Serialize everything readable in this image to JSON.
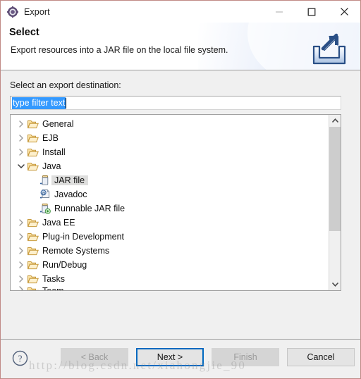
{
  "window": {
    "title": "Export",
    "title_icon": "export-wizard-icon",
    "controls": [
      {
        "name": "minimize-button",
        "glyph": "minimize-icon",
        "disabled": true
      },
      {
        "name": "maximize-button",
        "glyph": "maximize-icon",
        "disabled": false
      },
      {
        "name": "close-button",
        "glyph": "close-icon",
        "disabled": false
      }
    ]
  },
  "banner": {
    "title": "Select",
    "description": "Export resources into a JAR file on the local file system.",
    "icon": "export-arrow-tray-icon"
  },
  "form": {
    "label": "Select an export destination:",
    "filter": {
      "value": "type filter text",
      "placeholder": "type filter text",
      "selected": true
    }
  },
  "tree": {
    "items": [
      {
        "label": "General",
        "icon": "folder-icon",
        "twisty": "chevron-right-icon",
        "level": 1,
        "expanded": false,
        "selected": false
      },
      {
        "label": "EJB",
        "icon": "folder-icon",
        "twisty": "chevron-right-icon",
        "level": 1,
        "expanded": false,
        "selected": false
      },
      {
        "label": "Install",
        "icon": "folder-icon",
        "twisty": "chevron-right-icon",
        "level": 1,
        "expanded": false,
        "selected": false
      },
      {
        "label": "Java",
        "icon": "folder-icon",
        "twisty": "chevron-down-icon",
        "level": 1,
        "expanded": true,
        "selected": false
      },
      {
        "label": "JAR file",
        "icon": "jar-file-icon",
        "twisty": "",
        "level": 2,
        "expanded": false,
        "selected": true
      },
      {
        "label": "Javadoc",
        "icon": "javadoc-icon",
        "twisty": "",
        "level": 2,
        "expanded": false,
        "selected": false
      },
      {
        "label": "Runnable JAR file",
        "icon": "runnable-jar-icon",
        "twisty": "",
        "level": 2,
        "expanded": false,
        "selected": false
      },
      {
        "label": "Java EE",
        "icon": "folder-icon",
        "twisty": "chevron-right-icon",
        "level": 1,
        "expanded": false,
        "selected": false
      },
      {
        "label": "Plug-in Development",
        "icon": "folder-icon",
        "twisty": "chevron-right-icon",
        "level": 1,
        "expanded": false,
        "selected": false
      },
      {
        "label": "Remote Systems",
        "icon": "folder-icon",
        "twisty": "chevron-right-icon",
        "level": 1,
        "expanded": false,
        "selected": false
      },
      {
        "label": "Run/Debug",
        "icon": "folder-icon",
        "twisty": "chevron-right-icon",
        "level": 1,
        "expanded": false,
        "selected": false
      },
      {
        "label": "Tasks",
        "icon": "folder-icon",
        "twisty": "chevron-right-icon",
        "level": 1,
        "expanded": false,
        "selected": false
      },
      {
        "label": "Team",
        "icon": "folder-icon",
        "twisty": "chevron-right-icon",
        "level": 1,
        "expanded": false,
        "selected": false,
        "clipped": true
      }
    ],
    "scrollbar": {
      "up_icon": "scroll-up-arrow-icon",
      "down_icon": "scroll-down-arrow-icon",
      "thumb_position_percent": 0,
      "thumb_size_percent": 69
    }
  },
  "footer": {
    "help_icon": "help-question-icon",
    "buttons": [
      {
        "name": "back-button",
        "label": "< Back",
        "state": "disabled"
      },
      {
        "name": "next-button",
        "label": "Next >",
        "state": "default"
      },
      {
        "name": "finish-button",
        "label": "Finish",
        "state": "disabled"
      },
      {
        "name": "cancel-button",
        "label": "Cancel",
        "state": "normal"
      }
    ]
  },
  "watermark": {
    "text": "http://blog.csdn.net/xiahongjie_90"
  },
  "colors": {
    "selection_blue": "#3399ff",
    "focus_border_blue": "#0069c0",
    "folder_gold": "#f2c14e",
    "window_border": "#c08a86",
    "body_gray": "#f0f0f0"
  }
}
